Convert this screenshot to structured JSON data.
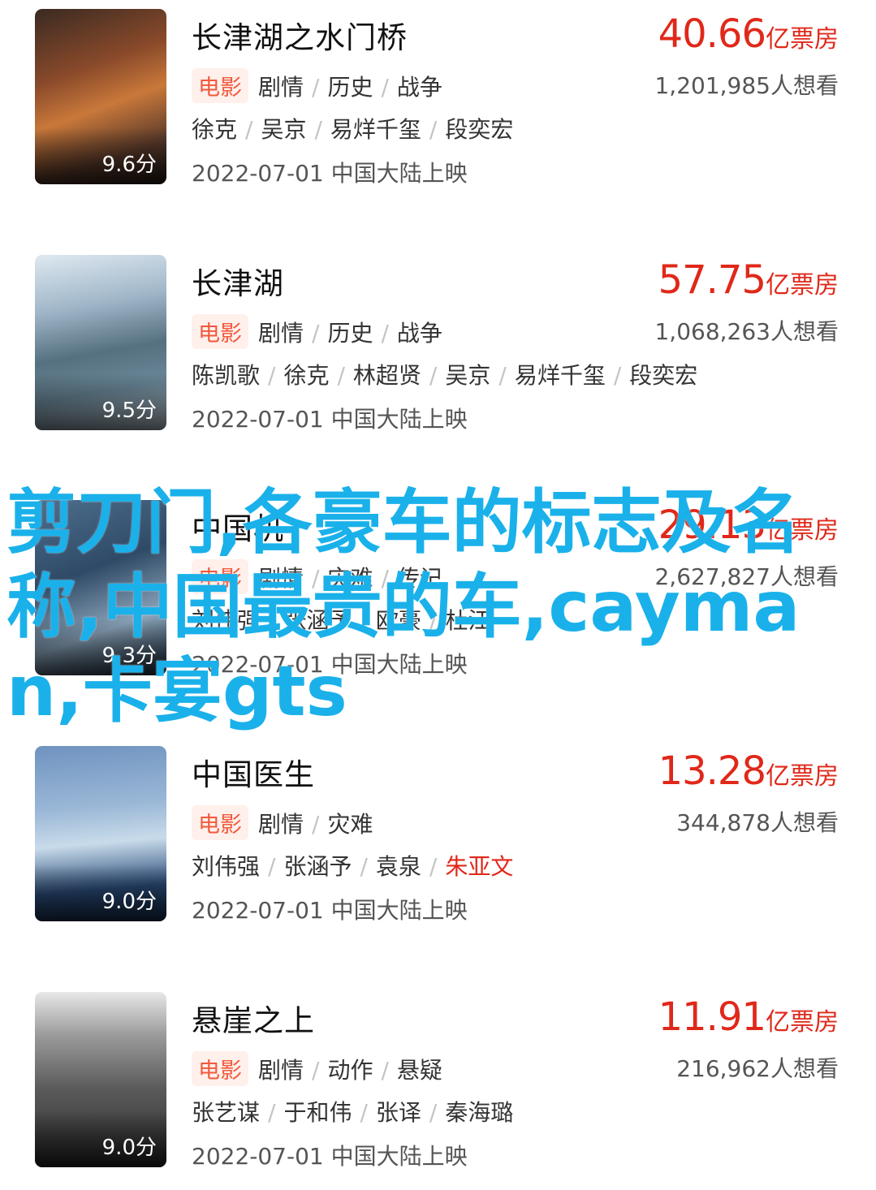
{
  "overlay_text": "剪刀门,各豪车的标志及名称,中国最贵的车,cayman,卡宴gts",
  "colors": {
    "box_office": "#e0281a",
    "badge_bg": "#fff0ec",
    "badge_fg": "#f15a3c",
    "overlay": "#1ab1ea"
  },
  "movies": [
    {
      "title": "长津湖之水门桥",
      "score": "9.6分",
      "badge": "电影",
      "genres": [
        "剧情",
        "历史",
        "战争"
      ],
      "cast": [
        "徐克",
        "吴京",
        "易烊千玺",
        "段奕宏"
      ],
      "release": "2022-07-01 中国大陆上映",
      "box_number": "40.66",
      "box_unit": "亿票房",
      "want": "1,201,985人想看"
    },
    {
      "title": "长津湖",
      "score": "9.5分",
      "badge": "电影",
      "genres": [
        "剧情",
        "历史",
        "战争"
      ],
      "cast": [
        "陈凯歌",
        "徐克",
        "林超贤",
        "吴京",
        "易烊千玺",
        "段奕宏"
      ],
      "release": "2022-07-01 中国大陆上映",
      "box_number": "57.75",
      "box_unit": "亿票房",
      "want": "1,068,263人想看"
    },
    {
      "title": "中国机",
      "score": "9.3分",
      "badge": "电影",
      "genres": [
        "剧情",
        "灾难",
        "传记"
      ],
      "cast": [
        "刘伟强",
        "张涵予",
        "欧豪",
        "杜江"
      ],
      "release": "2022-07-01 中国大陆上映",
      "box_number": "29.13",
      "box_unit": "亿票房",
      "want": "2,627,827人想看"
    },
    {
      "title": "中国医生",
      "score": "9.0分",
      "badge": "电影",
      "genres": [
        "剧情",
        "灾难"
      ],
      "cast": [
        "刘伟强",
        "张涵予",
        "袁泉",
        "朱亚文"
      ],
      "cast_highlight": "朱亚文",
      "release": "2022-07-01 中国大陆上映",
      "box_number": "13.28",
      "box_unit": "亿票房",
      "want": "344,878人想看"
    },
    {
      "title": "悬崖之上",
      "score": "9.0分",
      "badge": "电影",
      "genres": [
        "剧情",
        "动作",
        "悬疑"
      ],
      "cast": [
        "张艺谋",
        "于和伟",
        "张译",
        "秦海璐"
      ],
      "release": "2022-07-01 中国大陆上映",
      "box_number": "11.91",
      "box_unit": "亿票房",
      "want": "216,962人想看"
    }
  ]
}
